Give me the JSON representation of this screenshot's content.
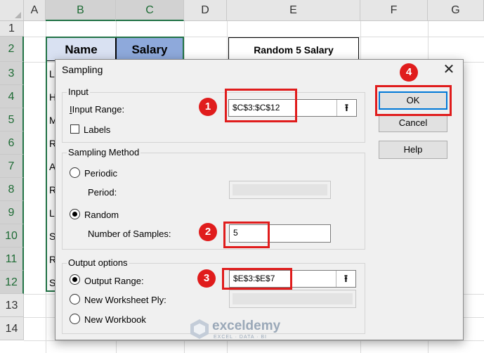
{
  "sheet": {
    "columns": [
      "A",
      "B",
      "C",
      "D",
      "E",
      "F",
      "G"
    ],
    "rows": [
      "1",
      "2",
      "3",
      "4",
      "5",
      "6",
      "7",
      "8",
      "9",
      "10",
      "11",
      "12",
      "13",
      "14"
    ],
    "header_name": "Name",
    "header_salary": "Salary",
    "output_header": "Random 5 Salary",
    "name_initials": [
      "L",
      "H",
      "M",
      "R",
      "A",
      "R",
      "L",
      "S",
      "R",
      "S"
    ]
  },
  "dialog": {
    "title": "Sampling",
    "close_glyph": "✕",
    "input_group": "Input",
    "input_range_label": "Input Range:",
    "input_range_value": "$C$3:$C$12",
    "labels_checkbox": "Labels",
    "sampling_group": "Sampling Method",
    "periodic_label": "Periodic",
    "period_label": "Period:",
    "random_label": "Random",
    "num_samples_label": "Number of Samples:",
    "num_samples_value": "5",
    "output_group": "Output options",
    "output_range_label": "Output Range:",
    "output_range_value": "$E$3:$E$7",
    "new_ply_label": "New Worksheet Ply:",
    "new_workbook_label": "New Workbook",
    "ok_label": "OK",
    "cancel_label": "Cancel",
    "help_label": "Help",
    "ref_glyph": "⭱"
  },
  "state": {
    "selected_method": "Random",
    "selected_output": "Output Range",
    "labels_checked": false
  },
  "annotations": {
    "step1": "1",
    "step2": "2",
    "step3": "3",
    "step4": "4",
    "highlight_color": "#e01c1c"
  },
  "watermark": {
    "name": "exceldemy",
    "tagline": "EXCEL · DATA · BI"
  },
  "colors": {
    "accent_green": "#217346",
    "name_header_bg": "#d9e1f2",
    "salary_header_bg": "#8ea9db",
    "default_button_border": "#0078d7"
  }
}
